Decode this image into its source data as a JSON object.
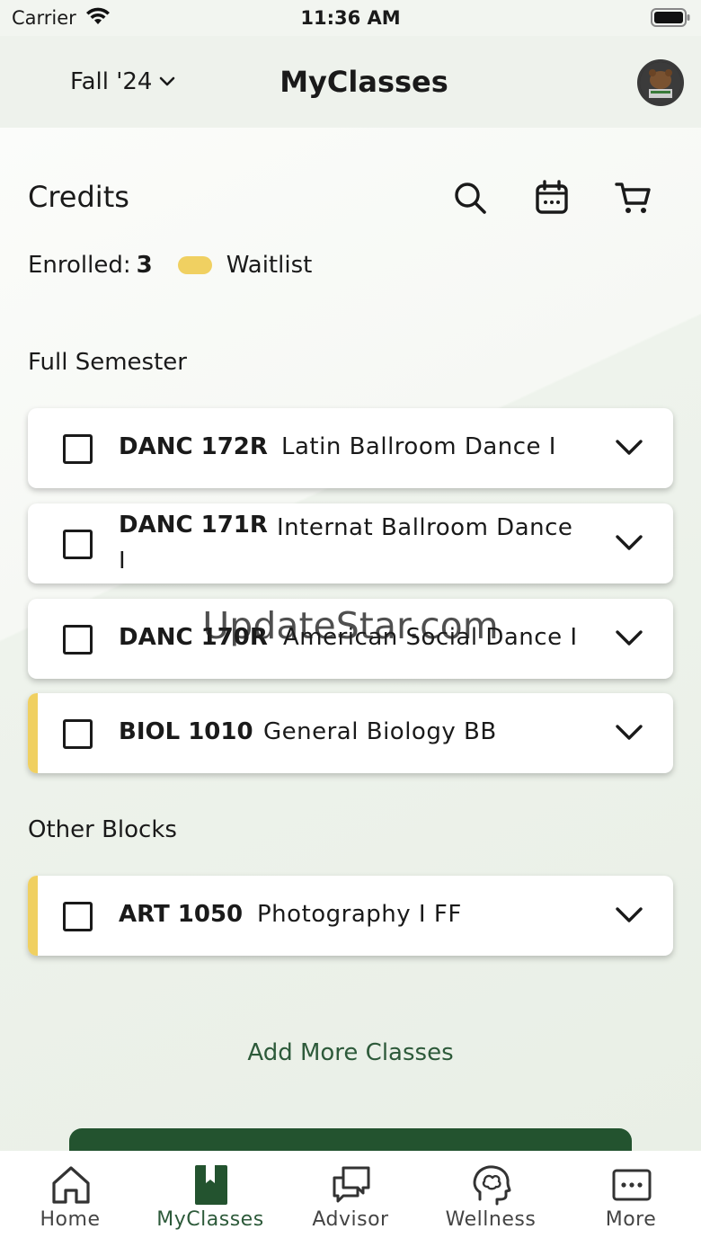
{
  "status_bar": {
    "carrier": "Carrier",
    "time": "11:36 AM"
  },
  "header": {
    "term": "Fall '24",
    "title": "MyClasses"
  },
  "credits": {
    "title": "Credits",
    "enrolled_label": "Enrolled:",
    "enrolled_count": "3",
    "waitlist_label": "Waitlist"
  },
  "sections": [
    {
      "title": "Full Semester",
      "classes": [
        {
          "code": "DANC 172R",
          "name": "Latin Ballroom Dance I",
          "waitlist": false
        },
        {
          "code": "DANC 171R",
          "name": "Internat Ballroom Dance I",
          "waitlist": false
        },
        {
          "code": "DANC 170R",
          "name": "American Social Dance I",
          "waitlist": false
        },
        {
          "code": "BIOL 1010",
          "name": "General Biology BB",
          "waitlist": true
        }
      ]
    },
    {
      "title": "Other Blocks",
      "classes": [
        {
          "code": "ART 1050",
          "name": "Photography I FF",
          "waitlist": true
        }
      ]
    }
  ],
  "add_more_label": "Add More Classes",
  "watermark": "UpdateStar.com",
  "tabs": [
    {
      "label": "Home",
      "icon": "home-icon"
    },
    {
      "label": "MyClasses",
      "icon": "book-icon",
      "active": true
    },
    {
      "label": "Advisor",
      "icon": "chat-icon"
    },
    {
      "label": "Wellness",
      "icon": "brain-icon"
    },
    {
      "label": "More",
      "icon": "more-icon"
    }
  ],
  "colors": {
    "accent": "#2d5a3a",
    "button": "#23532f",
    "waitlist": "#f0d061"
  }
}
